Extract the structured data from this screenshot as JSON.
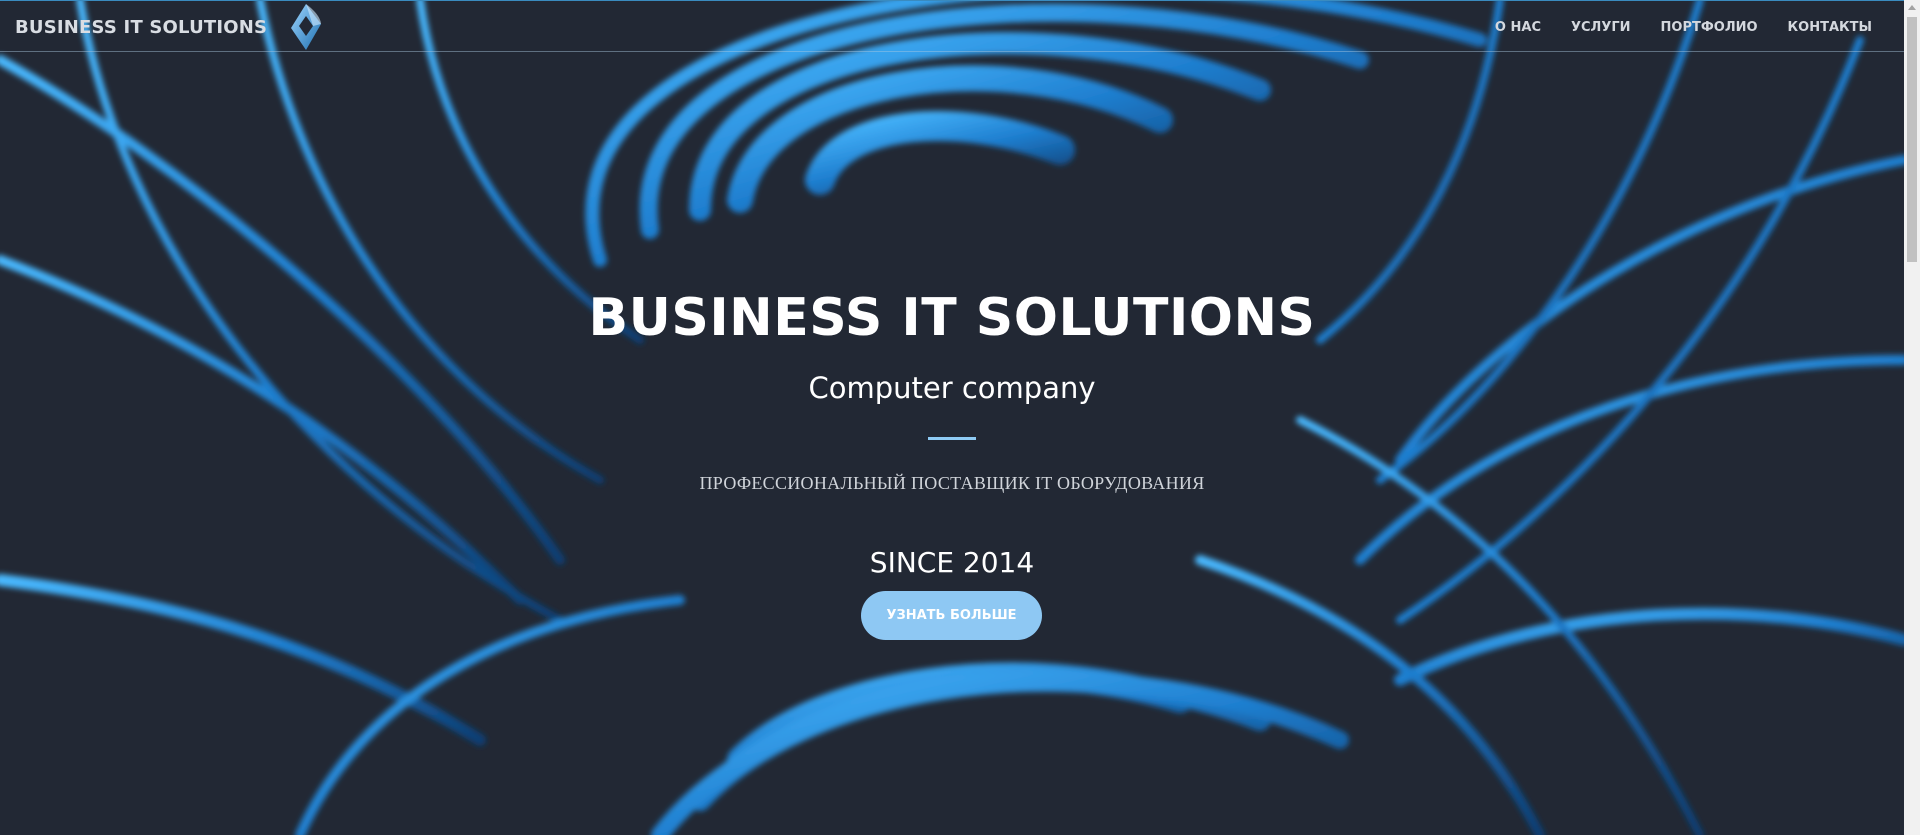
{
  "header": {
    "brand": "BUSINESS IT SOLUTIONS",
    "logo_icon": "diamond-swirl-logo-icon",
    "nav": [
      {
        "label": "О НАС"
      },
      {
        "label": "УСЛУГИ"
      },
      {
        "label": "ПОРТФОЛИО"
      },
      {
        "label": "КОНТАКТЫ"
      }
    ]
  },
  "hero": {
    "title": "BUSINESS IT SOLUTIONS",
    "subtitle": "Computer company",
    "tagline": "ПРОФЕССИОНАЛЬНЫЙ ПОСТАВЩИК IT ОБОРУДОВАНИЯ",
    "since": "SINCE 2014",
    "cta_label": "УЗНАТЬ БОЛЬШЕ"
  },
  "colors": {
    "background": "#222834",
    "accent": "#8ec8f3",
    "swirl": "#2d95e0"
  }
}
